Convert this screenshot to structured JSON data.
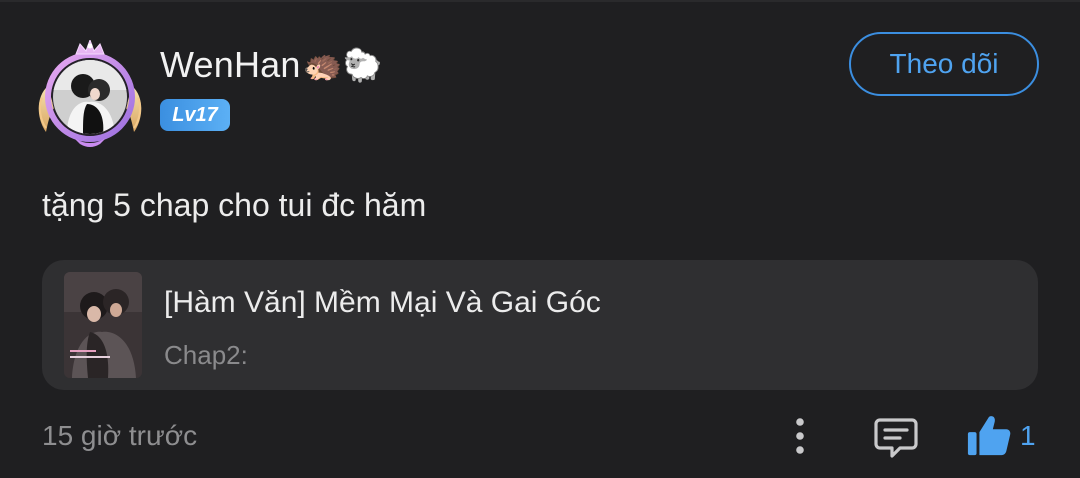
{
  "comment": {
    "username": "WenHan",
    "username_emojis": "🦔🐑",
    "level": "Lv17",
    "follow_label": "Theo dõi",
    "text": "tặng 5 chap cho tui đc hăm",
    "timestamp": "15 giờ trước",
    "like_count": "1"
  },
  "linked_chapter": {
    "title": "[Hàm Văn] Mềm Mại Và Gai Góc",
    "subtitle": "Chap2:"
  },
  "icons": {
    "avatar_frame": "crown-wings-frame-icon",
    "more": "more-vertical-icon",
    "reply": "comment-icon",
    "like": "thumbs-up-icon"
  },
  "colors": {
    "accent": "#4fa3f0",
    "badge": "#4a9de8",
    "background": "#1f1f21",
    "card": "#2f2f31"
  }
}
